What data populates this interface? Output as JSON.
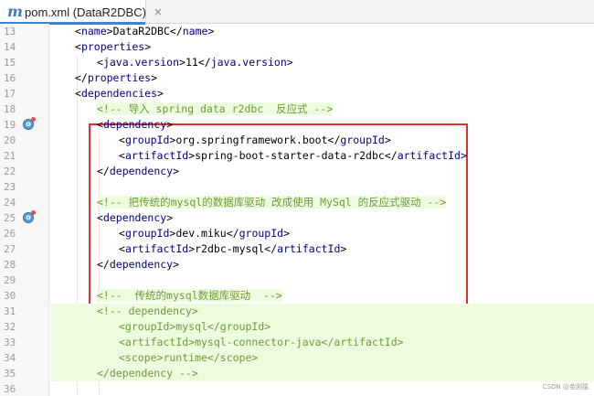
{
  "tab": {
    "icon": "m",
    "title": "pom.xml (DataR2DBC)",
    "close": "×"
  },
  "lines": [
    {
      "num": "13",
      "indent": 1,
      "kind": "el",
      "tag": "name",
      "value": "DataR2DBC"
    },
    {
      "num": "14",
      "indent": 1,
      "kind": "open",
      "tag": "properties"
    },
    {
      "num": "15",
      "indent": 2,
      "kind": "el",
      "tag": "java.version",
      "value": "11"
    },
    {
      "num": "16",
      "indent": 1,
      "kind": "close",
      "tag": "properties"
    },
    {
      "num": "17",
      "indent": 1,
      "kind": "open",
      "tag": "dependencies"
    },
    {
      "num": "18",
      "indent": 2,
      "kind": "comment",
      "text": "<!-- 导入 spring data r2dbc  反应式 -->",
      "hl": true
    },
    {
      "num": "19",
      "indent": 2,
      "kind": "open",
      "tag": "dependency",
      "icon": true
    },
    {
      "num": "20",
      "indent": 3,
      "kind": "el",
      "tag": "groupId",
      "value": "org.springframework.boot"
    },
    {
      "num": "21",
      "indent": 3,
      "kind": "el",
      "tag": "artifactId",
      "value": "spring-boot-starter-data-r2dbc"
    },
    {
      "num": "22",
      "indent": 2,
      "kind": "close",
      "tag": "dependency"
    },
    {
      "num": "23",
      "indent": 0,
      "kind": "blank"
    },
    {
      "num": "24",
      "indent": 2,
      "kind": "comment",
      "text": "<!-- 把传统的mysql的数据库驱动 改成使用 MySql 的反应式驱动 -->",
      "hl": true
    },
    {
      "num": "25",
      "indent": 2,
      "kind": "open",
      "tag": "dependency",
      "icon": true
    },
    {
      "num": "26",
      "indent": 3,
      "kind": "el",
      "tag": "groupId",
      "value": "dev.miku"
    },
    {
      "num": "27",
      "indent": 3,
      "kind": "el",
      "tag": "artifactId",
      "value": "r2dbc-mysql"
    },
    {
      "num": "28",
      "indent": 2,
      "kind": "close",
      "tag": "dependency"
    },
    {
      "num": "29",
      "indent": 0,
      "kind": "blank"
    },
    {
      "num": "30",
      "indent": 2,
      "kind": "comment",
      "text": "<!--  传统的mysql数据库驱动  -->",
      "hl": true
    },
    {
      "num": "31",
      "indent": 2,
      "kind": "comment",
      "text": "<!-- dependency>",
      "hl": true,
      "fullhl": true
    },
    {
      "num": "32",
      "indent": 3,
      "kind": "comment",
      "text": "<groupId>mysql</groupId>",
      "hl": true,
      "fullhl": true
    },
    {
      "num": "33",
      "indent": 3,
      "kind": "comment",
      "text": "<artifactId>mysql-connector-java</artifactId>",
      "hl": true,
      "fullhl": true
    },
    {
      "num": "34",
      "indent": 3,
      "kind": "comment",
      "text": "<scope>runtime</scope>",
      "hl": true,
      "fullhl": true
    },
    {
      "num": "35",
      "indent": 2,
      "kind": "comment",
      "text": "</dependency -->",
      "hl": true,
      "fullhl": true
    },
    {
      "num": "36",
      "indent": 1,
      "kind": "blank"
    }
  ],
  "watermark": "CSDN @金刚猿",
  "colors": {
    "tag": "#000080",
    "comment": "#6f9a39",
    "highlight": "#edfcdf",
    "annotation": "#e12d2d"
  },
  "icons": {
    "tab": "maven-m-icon",
    "gutter": "maven-dependency-icon"
  }
}
